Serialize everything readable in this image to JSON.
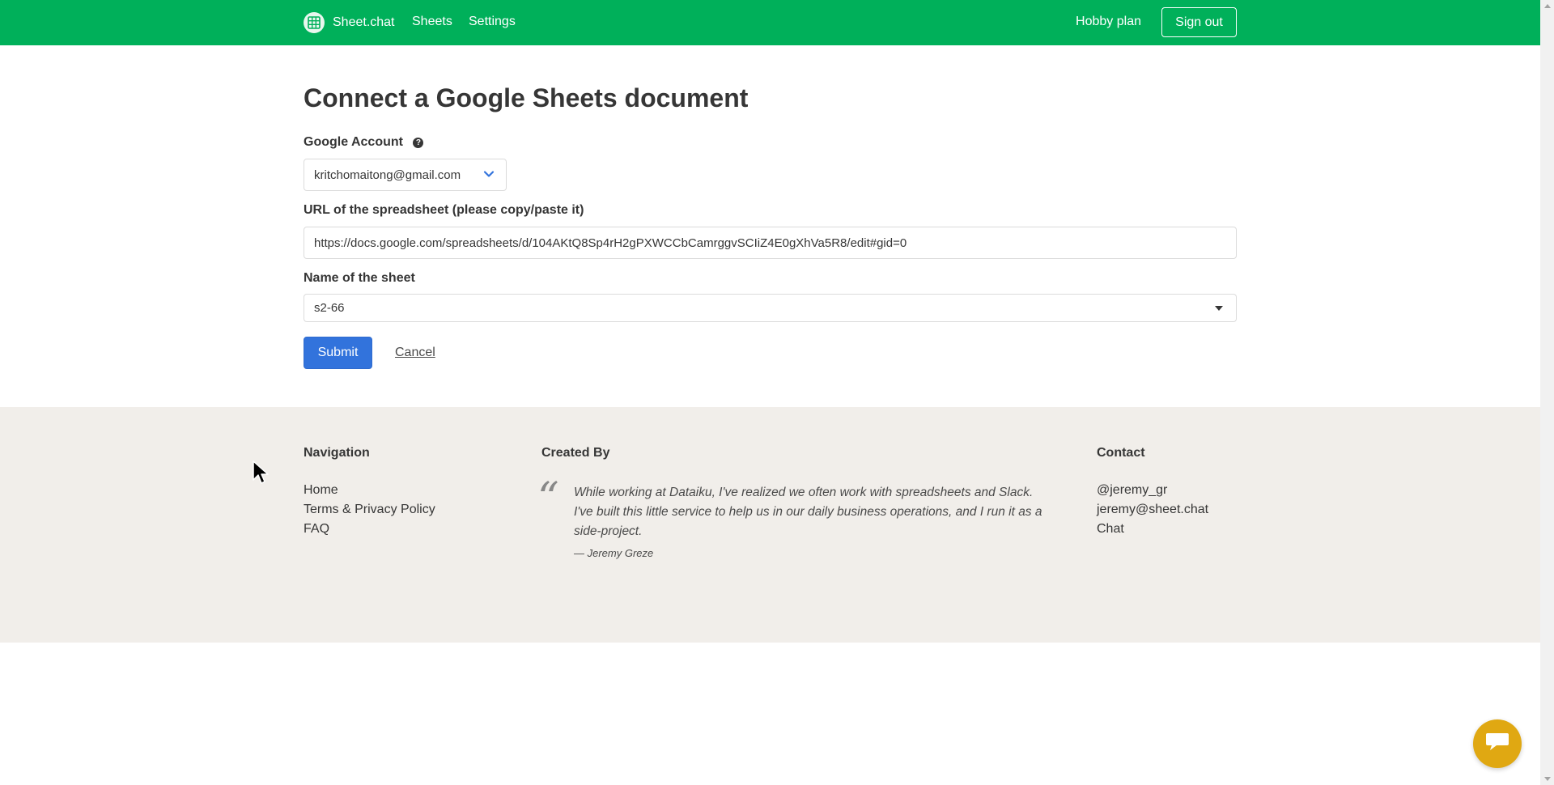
{
  "nav": {
    "brand": "Sheet.chat",
    "brand_icon": "spreadsheet-grid-icon",
    "links": [
      "Sheets",
      "Settings"
    ],
    "plan": "Hobby plan",
    "signout": "Sign out"
  },
  "form": {
    "title": "Connect a Google Sheets document",
    "account_label": "Google Account",
    "account_help_icon": "question-circle-icon",
    "account_value": "kritchomaitong@gmail.com",
    "url_label": "URL of the spreadsheet (please copy/paste it)",
    "url_value": "https://docs.google.com/spreadsheets/d/104AKtQ8Sp4rH2gPXWCCbCamrggvSCIiZ4E0gXhVa5R8/edit#gid=0",
    "sheet_label": "Name of the sheet",
    "sheet_value": "s2-66",
    "submit": "Submit",
    "cancel": "Cancel"
  },
  "footer": {
    "navigation": {
      "heading": "Navigation",
      "links": [
        "Home",
        "Terms & Privacy Policy",
        "FAQ"
      ]
    },
    "created_by": {
      "heading": "Created By",
      "quote": "While working at Dataiku, I've realized we often work with spreadsheets and Slack. I've built this little service to help us in our daily business operations, and I run it as a side-project.",
      "author": "— Jeremy Greze"
    },
    "contact": {
      "heading": "Contact",
      "links": [
        "@jeremy_gr",
        "jeremy@sheet.chat",
        "Chat"
      ]
    }
  },
  "colors": {
    "navbar": "#00b05a",
    "primary_button": "#3273dc",
    "footer_bg": "#f1eeea",
    "chat_button": "#e0a812"
  },
  "chat_icon": "chat-bubble-icon"
}
